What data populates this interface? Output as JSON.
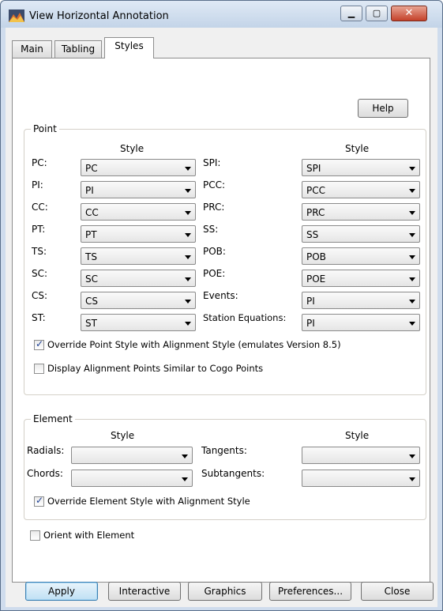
{
  "window": {
    "title": "View Horizontal Annotation",
    "controls": {
      "minimize_icon": "minimize-icon",
      "maximize_icon": "maximize-icon",
      "close_icon": "close-icon"
    }
  },
  "tabs": [
    {
      "label": "Main"
    },
    {
      "label": "Tabling"
    },
    {
      "label": "Styles"
    }
  ],
  "help_label": "Help",
  "point": {
    "legend": "Point",
    "style_header": "Style",
    "left": [
      {
        "label": "PC:",
        "value": "PC"
      },
      {
        "label": "PI:",
        "value": "PI"
      },
      {
        "label": "CC:",
        "value": "CC"
      },
      {
        "label": "PT:",
        "value": "PT"
      },
      {
        "label": "TS:",
        "value": "TS"
      },
      {
        "label": "SC:",
        "value": "SC"
      },
      {
        "label": "CS:",
        "value": "CS"
      },
      {
        "label": "ST:",
        "value": "ST"
      }
    ],
    "right": [
      {
        "label": "SPI:",
        "value": "SPI"
      },
      {
        "label": "PCC:",
        "value": "PCC"
      },
      {
        "label": "PRC:",
        "value": "PRC"
      },
      {
        "label": "SS:",
        "value": "SS"
      },
      {
        "label": "POB:",
        "value": "POB"
      },
      {
        "label": "POE:",
        "value": "POE"
      },
      {
        "label": "Events:",
        "value": "PI"
      },
      {
        "label": "Station Equations:",
        "value": "PI"
      }
    ],
    "override_label": "Override Point Style with Alignment Style (emulates Version 8.5)",
    "override_checked": true,
    "display_cogo_label": "Display Alignment Points Similar to Cogo Points",
    "display_cogo_checked": false
  },
  "element": {
    "legend": "Element",
    "style_header": "Style",
    "radials_label": "Radials:",
    "radials_value": "",
    "chords_label": "Chords:",
    "chords_value": "",
    "tangents_label": "Tangents:",
    "tangents_value": "",
    "subtangents_label": "Subtangents:",
    "subtangents_value": "",
    "override_label": "Override Element Style with Alignment Style",
    "override_checked": true
  },
  "orient_label": "Orient with Element",
  "orient_checked": false,
  "buttons": {
    "apply": "Apply",
    "interactive": "Interactive",
    "graphics": "Graphics",
    "preferences": "Preferences...",
    "close": "Close"
  }
}
